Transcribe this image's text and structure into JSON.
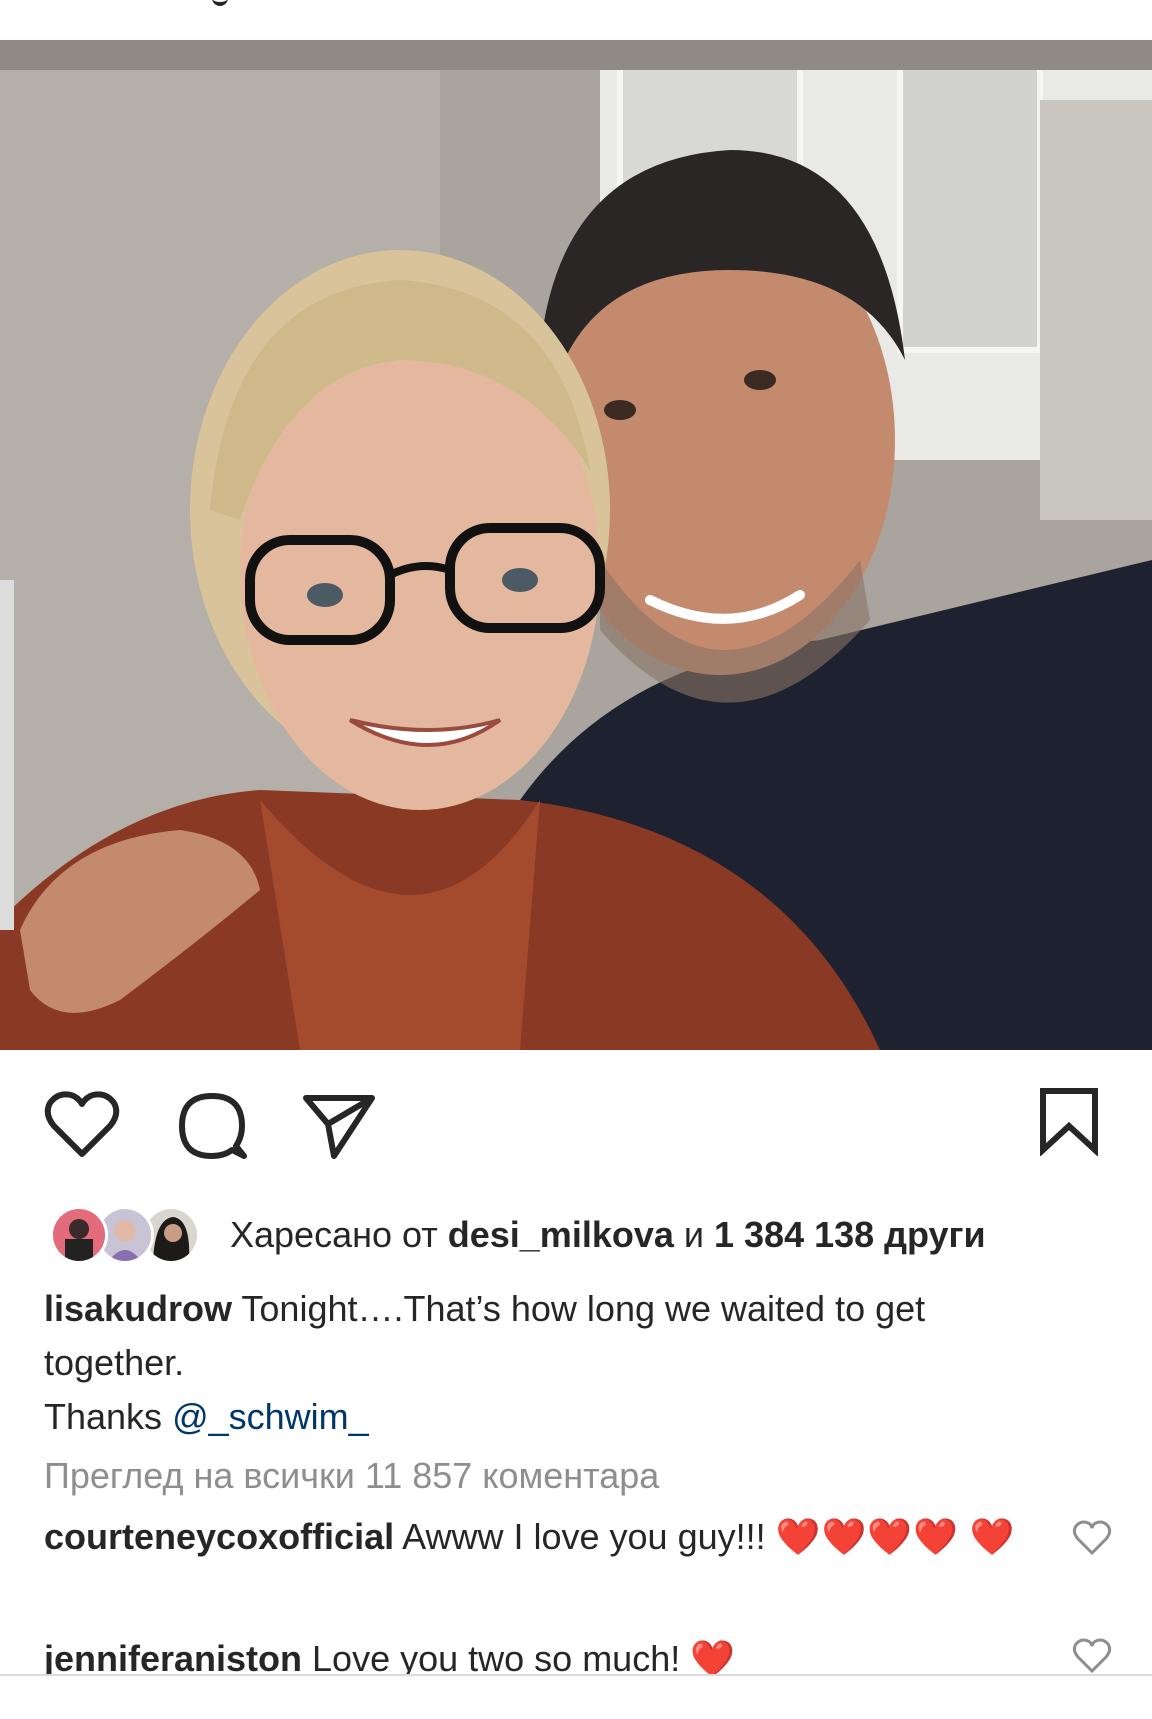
{
  "post": {
    "image_alt": "",
    "likes": {
      "prefix": "Харесано от",
      "user": "desi_milkova",
      "conj": "и",
      "count": "1 384 138 други"
    },
    "caption": {
      "username": "lisakudrow",
      "text_line1": " Tonight….That’s how long we waited to get together.",
      "text_thanks": "Thanks ",
      "mention": "@_schwim_"
    },
    "view_all_comments": "Преглед на всички 11 857 коментара",
    "comments": [
      {
        "username": "courteneycoxofficial",
        "text": " Awww I love you guy!!! ",
        "hearts": "❤️❤️❤️❤️ ❤️"
      },
      {
        "username": "jenniferaniston",
        "text": " Love you two so much! ",
        "hearts": "❤️"
      }
    ]
  },
  "icons": {
    "like": "heart-icon",
    "comment": "comment-bubble-icon",
    "share": "paper-plane-icon",
    "save": "bookmark-icon",
    "comment_like": "small-heart-icon"
  },
  "colors": {
    "text": "#262626",
    "secondary": "#8e8e8e",
    "mention": "#00376b",
    "heart_emoji": "#ed1c24"
  }
}
